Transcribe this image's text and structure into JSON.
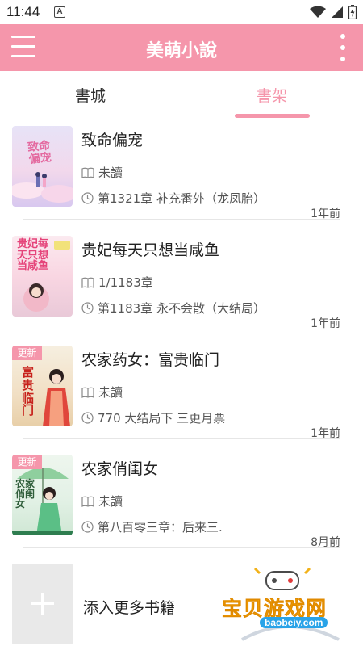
{
  "status_bar": {
    "time": "11:44",
    "notification_letter": "A",
    "icons": [
      "wifi-icon",
      "signal-icon",
      "battery-icon"
    ]
  },
  "app_bar": {
    "title": "美萌小說",
    "menu_icon": "hamburger-menu-icon",
    "more_icon": "more-vertical-icon",
    "background_color": "#f596ab"
  },
  "tabs": [
    {
      "label": "書城",
      "active": false
    },
    {
      "label": "書架",
      "active": true
    }
  ],
  "accent_color": "#f596ab",
  "books": [
    {
      "title": "致命偏宠",
      "progress": "未讀",
      "latest_chapter": "第1321章 补充番外（龙凤胎）",
      "updated": "1年前",
      "is_new": false,
      "cover_text": "致命偏宠"
    },
    {
      "title": "贵妃每天只想当咸鱼",
      "progress": "1/1183章",
      "latest_chapter": "第1183章 永不会散（大结局）",
      "updated": "1年前",
      "is_new": false,
      "cover_text": "贵妃每天只想当咸鱼"
    },
    {
      "title": "农家药女：富贵临门",
      "progress": "未讀",
      "latest_chapter": "770 大结局下 三更月票",
      "updated": "1年前",
      "is_new": true,
      "cover_text": "富贵临门"
    },
    {
      "title": "农家俏闺女",
      "progress": "未讀",
      "latest_chapter": "第八百零三章：后来三.",
      "updated": "8月前",
      "is_new": true,
      "cover_text": "农家俏闺女"
    }
  ],
  "new_badge_label": "更新",
  "add_more": {
    "label": "添入更多书籍",
    "icon": "plus-icon"
  },
  "watermark": {
    "text": "宝贝游戏网",
    "url": "baobeiy.com"
  }
}
